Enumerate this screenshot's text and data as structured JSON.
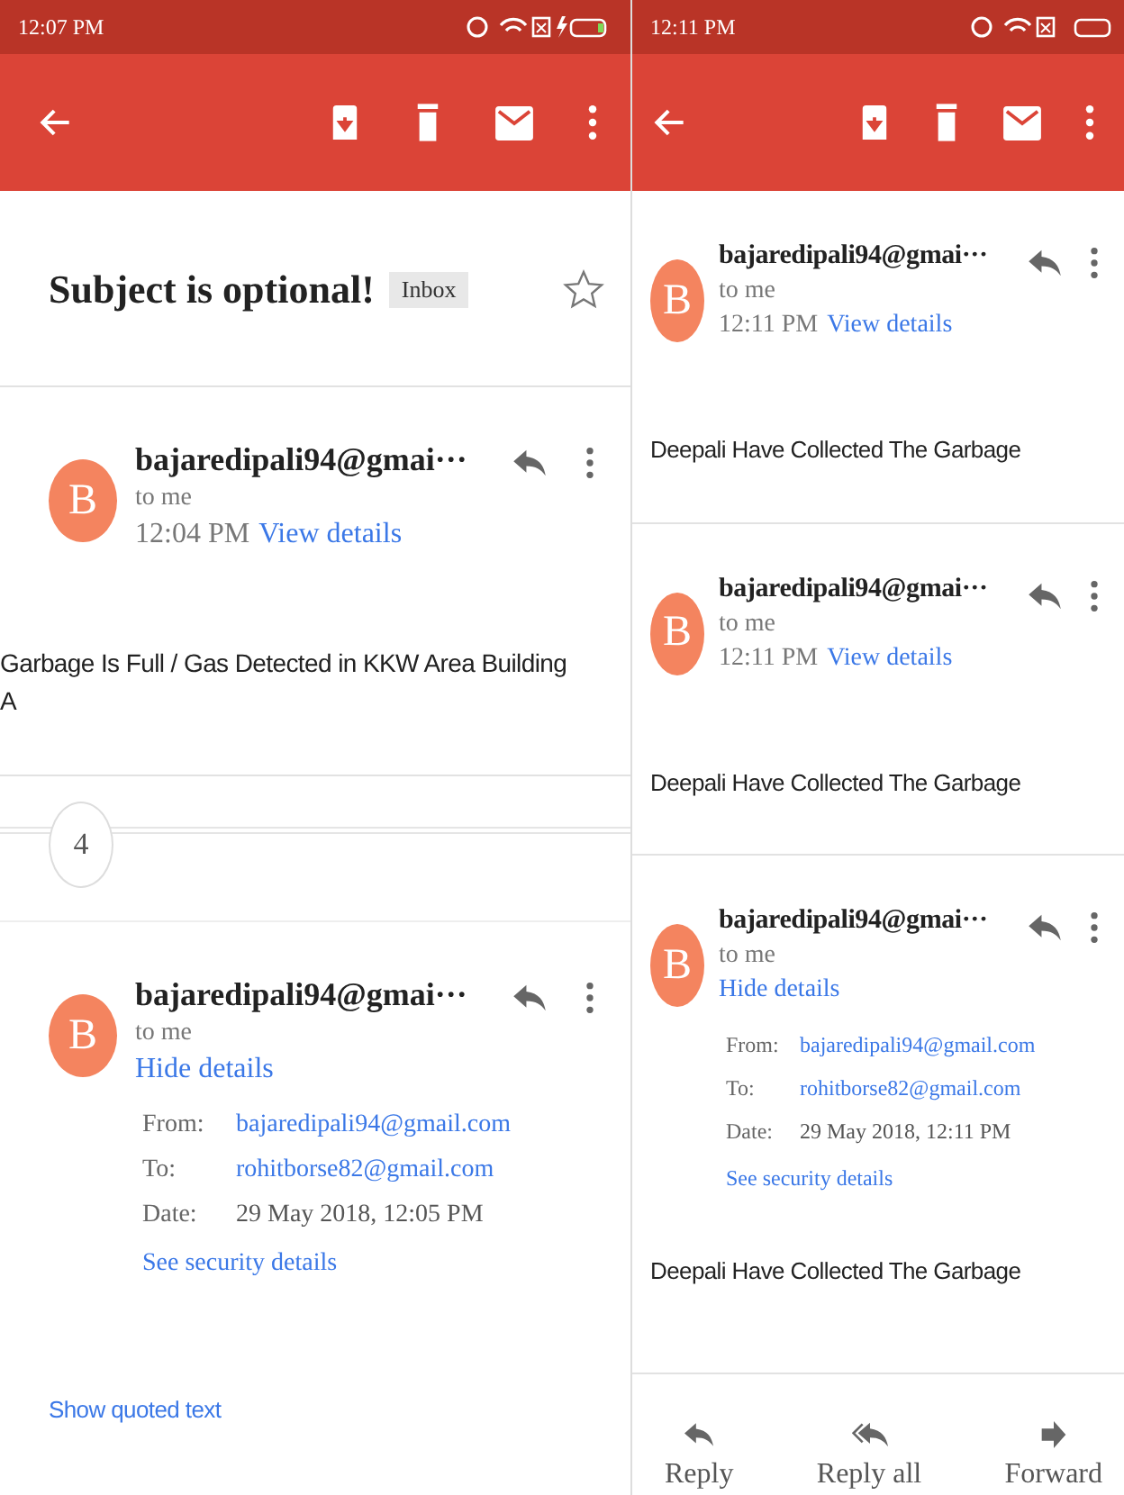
{
  "screens": [
    {
      "status_bar": {
        "time": "12:07 PM",
        "charging": true
      },
      "items": [
        {
          "kind": "subject",
          "title": "Subject is optional!",
          "label": "Inbox",
          "starred": false
        },
        {
          "kind": "message",
          "initial": "B",
          "sender": "bajaredipali94@gmai···",
          "recipient": "to me",
          "time": "12:04 PM",
          "details_link": "View details",
          "body": "Garbage Is Full / Gas Detected in KKW Area Building A"
        },
        {
          "kind": "collapsed",
          "count": "4"
        },
        {
          "kind": "message",
          "initial": "B",
          "sender": "bajaredipali94@gmai···",
          "recipient": "to me",
          "details_link": "Hide details",
          "details": [
            {
              "label": "From:",
              "value": "bajaredipali94@gmail.com",
              "link": true
            },
            {
              "label": "To:",
              "value": "rohitborse82@gmail.com",
              "link": true
            },
            {
              "label": "Date:",
              "value": "29 May 2018, 12:05 PM",
              "link": false
            }
          ],
          "security_link": "See security details"
        },
        {
          "kind": "quoted",
          "text": "Show quoted text"
        }
      ]
    },
    {
      "status_bar": {
        "time": "12:11 PM",
        "charging": false
      },
      "items": [
        {
          "kind": "message",
          "initial": "B",
          "sender": "bajaredipali94@gmai···",
          "recipient": "to me",
          "time": "12:11 PM",
          "details_link": "View details",
          "body": "Deepali Have Collected The Garbage"
        },
        {
          "kind": "message",
          "initial": "B",
          "sender": "bajaredipali94@gmai···",
          "recipient": "to me",
          "time": "12:11 PM",
          "details_link": "View details",
          "body": "Deepali Have Collected The Garbage"
        },
        {
          "kind": "message",
          "initial": "B",
          "sender": "bajaredipali94@gmai···",
          "recipient": "to me",
          "details_link": "Hide details",
          "details": [
            {
              "label": "From:",
              "value": "bajaredipali94@gmail.com",
              "link": true
            },
            {
              "label": "To:",
              "value": "rohitborse82@gmail.com",
              "link": true
            },
            {
              "label": "Date:",
              "value": "29 May 2018, 12:11 PM",
              "link": false
            }
          ],
          "security_link": "See security details",
          "body": "Deepali Have Collected The Garbage"
        },
        {
          "kind": "actions",
          "actions": [
            {
              "kind": "reply",
              "label": "Reply"
            },
            {
              "kind": "reply-all",
              "label": "Reply all"
            },
            {
              "kind": "forward",
              "label": "Forward"
            }
          ]
        }
      ]
    }
  ]
}
